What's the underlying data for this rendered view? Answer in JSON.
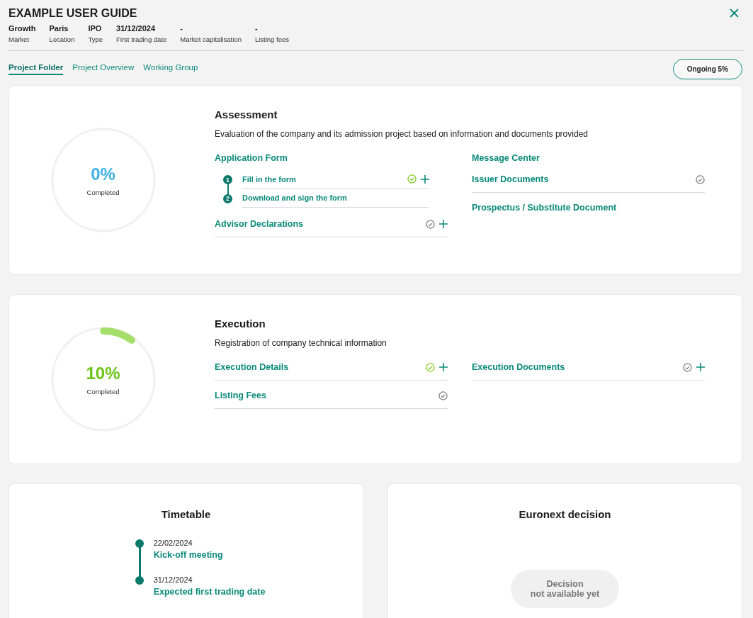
{
  "title": "EXAMPLE USER GUIDE",
  "meta": [
    {
      "value": "Growth",
      "label": "Market"
    },
    {
      "value": "Paris",
      "label": "Location"
    },
    {
      "value": "IPO",
      "label": "Type"
    },
    {
      "value": "31/12/2024",
      "label": "First trading date"
    },
    {
      "value": "-",
      "label": "Market capitalisation"
    },
    {
      "value": "-",
      "label": "Listing fees"
    }
  ],
  "tabs": [
    {
      "label": "Project Folder",
      "selected": true
    },
    {
      "label": "Project Overview",
      "selected": false
    },
    {
      "label": "Working Group",
      "selected": false
    }
  ],
  "status_badge": "Ongoing 5%",
  "phases": [
    {
      "title": "Assessment",
      "description": "Evaluation of the company and its admission project based on information and documents provided",
      "level": 0,
      "percent": "0%",
      "caption": "Completed",
      "columns": [
        [
          {
            "label": "Application Form",
            "kind": "heading",
            "steps": [
              {
                "number": "1",
                "label": "Fill in the form",
                "done": true,
                "addable": true
              },
              {
                "number": "2",
                "label": "Download and sign the form",
                "done": false,
                "addable": false
              }
            ]
          },
          {
            "label": "Advisor Declarations",
            "kind": "item",
            "done": false,
            "addable": true
          }
        ],
        [
          {
            "label": "Message Center",
            "kind": "heading"
          },
          {
            "label": "Issuer Documents",
            "kind": "item",
            "done": false,
            "addable": false
          },
          {
            "label": "Prospectus / Substitute Document",
            "kind": "heading"
          }
        ]
      ]
    },
    {
      "title": "Execution",
      "description": "Registration of company technical information",
      "level": 0.1,
      "percent": "10%",
      "caption": "Completed",
      "columns": [
        [
          {
            "label": "Execution Details",
            "kind": "item",
            "done": true,
            "addable": true
          },
          {
            "label": "Listing Fees",
            "kind": "item",
            "done": false,
            "addable": false
          }
        ],
        [
          {
            "label": "Execution Documents",
            "kind": "item",
            "done": false,
            "addable": true
          }
        ]
      ]
    }
  ],
  "timetable": {
    "title": "Timetable",
    "events": [
      {
        "date": "22/02/2024",
        "label": "Kick-off meeting"
      },
      {
        "date": "31/12/2024",
        "label": "Expected first trading date"
      }
    ]
  },
  "decision": {
    "title": "Euronext decision",
    "status": "Decision\nnot available yet"
  }
}
